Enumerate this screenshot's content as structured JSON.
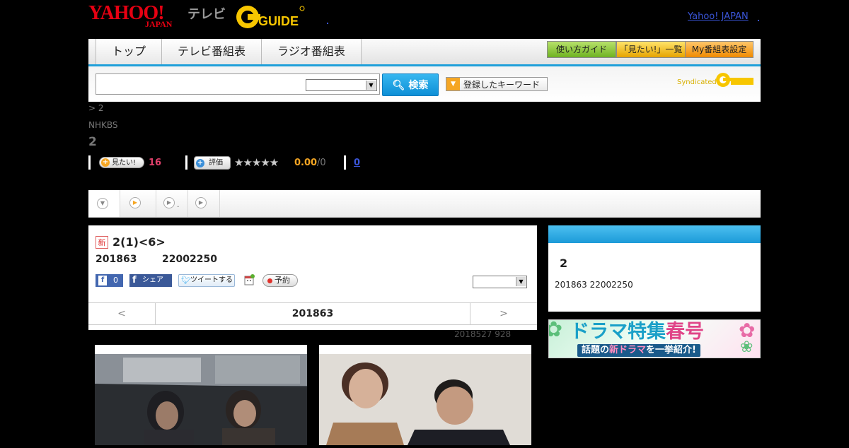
{
  "header": {
    "yahoo_logo_main": "YAHOO!",
    "yahoo_logo_sub": "JAPAN",
    "tv_label": "テレビ",
    "gguide_logo": "GUIDE",
    "yahoo_japan_link": "Yahoo! JAPAN"
  },
  "nav": {
    "tabs": [
      {
        "label": "トップ"
      },
      {
        "label": "テレビ番組表"
      },
      {
        "label": "ラジオ番組表"
      }
    ],
    "buttons": {
      "guide": "使い方ガイド",
      "mitai_list": "「見たい!」一覧",
      "my_schedule": "My番組表設定"
    }
  },
  "search": {
    "input_value": "",
    "select_value": "",
    "button_label": "検索",
    "keywords_label": "登録したキーワード",
    "syndicated_label": "Syndicated"
  },
  "breadcrumb": {
    "link": "",
    "separator": ">",
    "current": "2"
  },
  "program": {
    "station": "NHKBS",
    "title": "2",
    "mitai_label": "見たい!",
    "mitai_count": "16",
    "rate_label": "評価",
    "stars": "★★★★★",
    "score": "0.00",
    "score_max": "/0",
    "comments_count": "0"
  },
  "tabs_strip": {
    "tab2_label": "."
  },
  "episode": {
    "new_badge": "新",
    "title": "2(1)<6>",
    "date": "201863",
    "time": "22002250",
    "fb_like_count": "0",
    "fb_share": "シェア",
    "tweet": "ツイートする",
    "reserve": "予約",
    "select_value": ""
  },
  "pager": {
    "prev": "<",
    "current": "201863",
    "next": ">"
  },
  "updated": "2018527  928",
  "sidebar": {
    "title": "2",
    "subtitle": "201863  22002250"
  },
  "banner": {
    "line1_a": "ドラマ特集",
    "line1_b": "春号",
    "line2_a": "話題の",
    "line2_b": "新ドラマ",
    "line2_c": "を一挙紹介!"
  },
  "colors": {
    "accent_blue": "#1f9fd9",
    "yahoo_red": "#e60012",
    "mitai_pink": "#e0406b",
    "score_orange": "#f5a623"
  }
}
